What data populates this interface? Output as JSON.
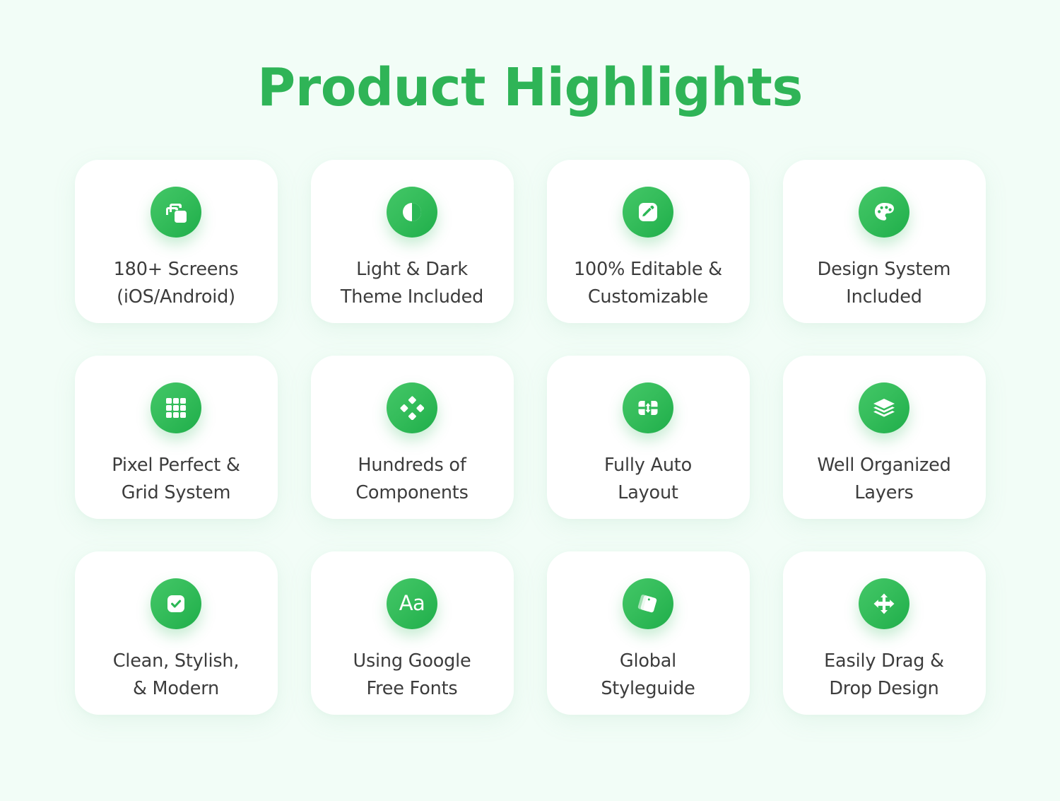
{
  "header": {
    "title": "Product Highlights",
    "title_color": "#2fb457"
  },
  "theme": {
    "background": "#f2fdf7",
    "card_background": "#ffffff",
    "accent_green": "#2fb457",
    "icon_gradient_start": "#43c767",
    "icon_gradient_end": "#1fae4a",
    "label_color": "#3c3c3c"
  },
  "cards": [
    {
      "icon": "copy-stack-icon",
      "label": "180+ Screens\n(iOS/Android)",
      "line1": "180+ Screens",
      "line2": "(iOS/Android)"
    },
    {
      "icon": "contrast-half-circle-icon",
      "label": "Light & Dark\nTheme Included",
      "line1": "Light & Dark",
      "line2": "Theme Included"
    },
    {
      "icon": "pencil-edit-icon",
      "label": "100% Editable &\nCustomizable",
      "line1": "100% Editable &",
      "line2": "Customizable"
    },
    {
      "icon": "palette-icon",
      "label": "Design System\nIncluded",
      "line1": "Design System",
      "line2": "Included"
    },
    {
      "icon": "grid-nine-squares-icon",
      "label": "Pixel Perfect &\nGrid System",
      "line1": "Pixel Perfect &",
      "line2": "Grid System"
    },
    {
      "icon": "four-diamonds-component-icon",
      "label": "Hundreds of\nComponents",
      "line1": "Hundreds of",
      "line2": "Components"
    },
    {
      "icon": "auto-layout-vertical-arrow-icon",
      "label": "Fully Auto\nLayout",
      "line1": "Fully Auto",
      "line2": "Layout"
    },
    {
      "icon": "layers-stack-icon",
      "label": "Well Organized\nLayers",
      "line1": "Well Organized",
      "line2": "Layers"
    },
    {
      "icon": "checkbox-checked-icon",
      "label": "Clean, Stylish,\n& Modern",
      "line1": "Clean, Stylish,",
      "line2": "& Modern"
    },
    {
      "icon": "font-aa-icon",
      "label": "Using Google\nFree Fonts",
      "line1": "Using Google",
      "line2": "Free Fonts"
    },
    {
      "icon": "style-swatches-icon",
      "label": "Global\nStyleguide",
      "line1": "Global",
      "line2": "Styleguide"
    },
    {
      "icon": "move-drag-arrows-icon",
      "label": "Easily Drag &\nDrop Design",
      "line1": "Easily Drag &",
      "line2": "Drop Design"
    }
  ]
}
